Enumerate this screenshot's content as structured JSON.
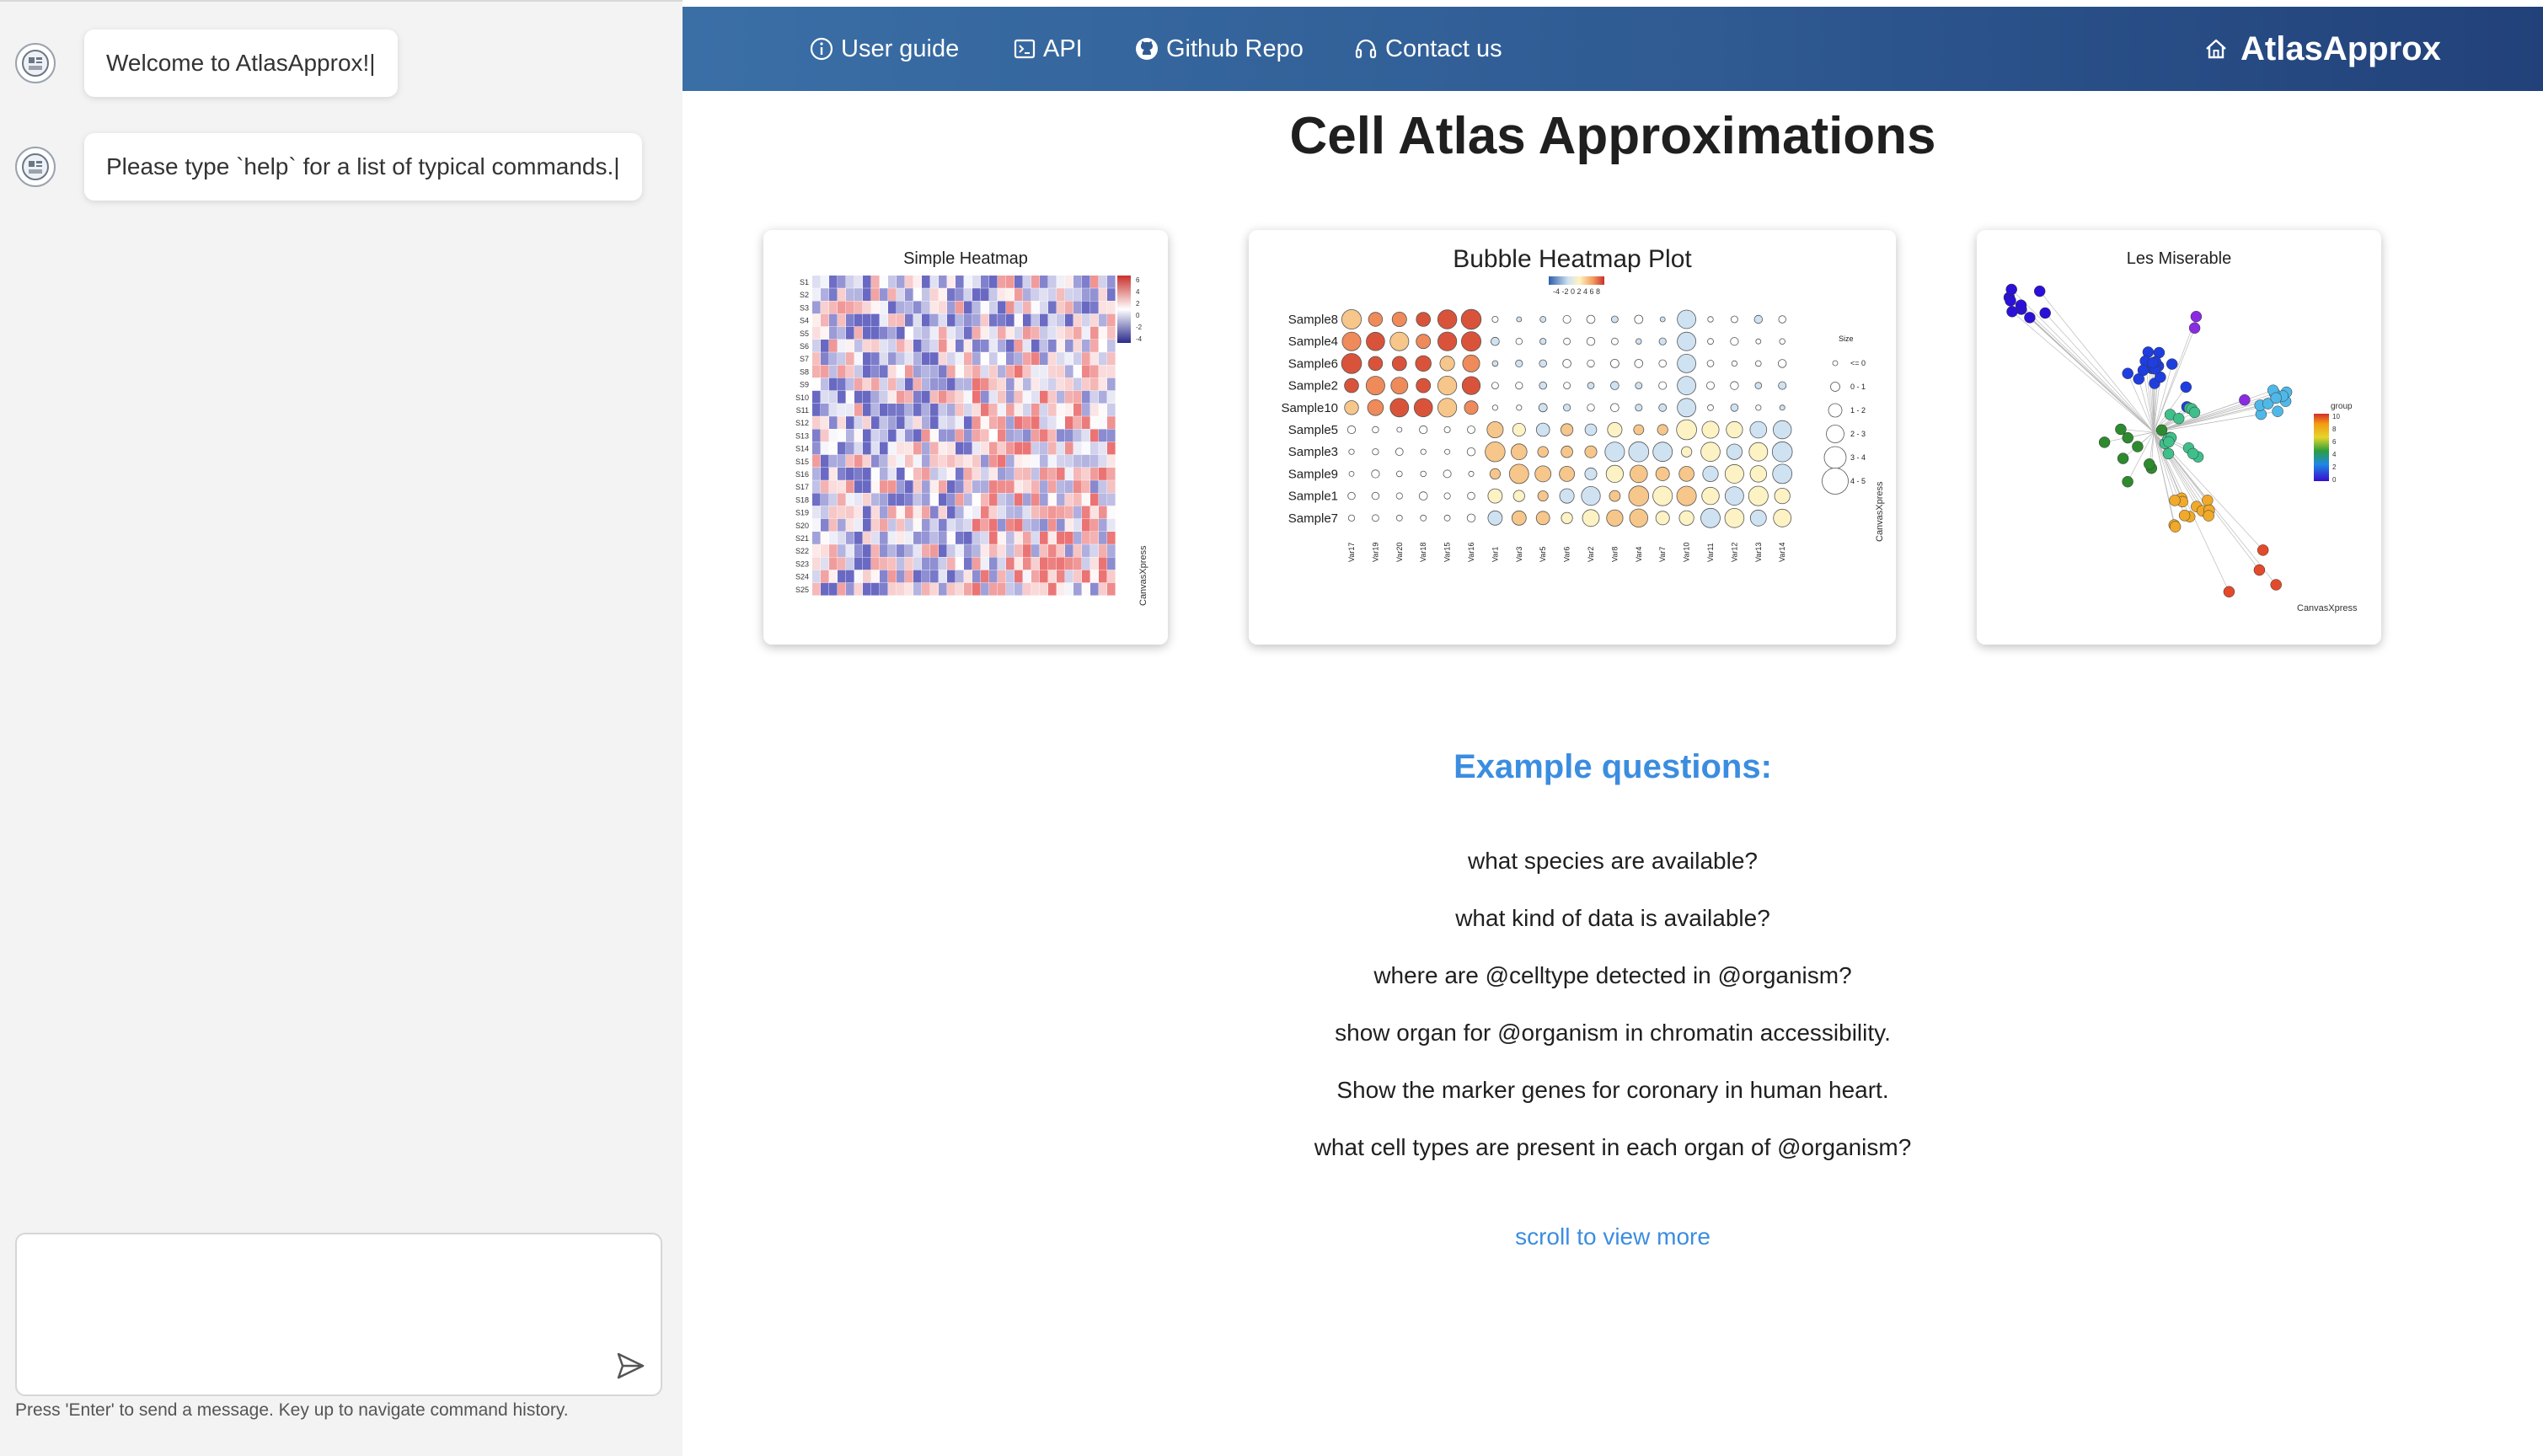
{
  "chat": {
    "messages": [
      {
        "text": "Welcome to AtlasApprox!|"
      },
      {
        "text": "Please type `help` for a list of typical commands.|"
      }
    ],
    "input_value": "",
    "hint": "Press 'Enter' to send a message. Key up to navigate command history."
  },
  "nav": {
    "items": [
      {
        "label": "User guide",
        "icon": "info-icon"
      },
      {
        "label": "API",
        "icon": "terminal-icon"
      },
      {
        "label": "Github Repo",
        "icon": "github-icon"
      },
      {
        "label": "Contact us",
        "icon": "headset-icon"
      }
    ],
    "brand": "AtlasApprox",
    "brand_icon": "home-icon",
    "color_start": "#3a6fa6",
    "color_end": "#22417a"
  },
  "main": {
    "title": "Cell Atlas Approximations",
    "examples_title": "Example questions:",
    "examples": [
      "what species are available?",
      "what kind of data is available?",
      "where are @celltype detected in @organism?",
      "show organ for @organism in chromatin accessibility.",
      "Show the marker genes for coronary in human heart.",
      "what cell types are present in each organ of @organism?"
    ],
    "scroll_more": "scroll to view more",
    "accent_color": "#3b8de0"
  },
  "cards": {
    "heatmap": {
      "title": "Simple Heatmap",
      "rows": [
        "S1",
        "S2",
        "S3",
        "S4",
        "S5",
        "S6",
        "S7",
        "S8",
        "S9",
        "S10",
        "S11",
        "S12",
        "S13",
        "S14",
        "S15",
        "S16",
        "S17",
        "S18",
        "S19",
        "S20",
        "S21",
        "S22",
        "S23",
        "S24",
        "S25"
      ],
      "legend_ticks": [
        "6",
        "4",
        "2",
        "0",
        "-2",
        "-4"
      ],
      "watermark": "CanvasXpress"
    },
    "bubble": {
      "title": "Bubble Heatmap Plot",
      "legend_scale": "-4 -2 0 2 4 6 8",
      "samples": [
        "Sample8",
        "Sample4",
        "Sample6",
        "Sample2",
        "Sample10",
        "Sample5",
        "Sample3",
        "Sample9",
        "Sample1",
        "Sample7"
      ],
      "vars": [
        "Var17",
        "Var19",
        "Var20",
        "Var18",
        "Var15",
        "Var16",
        "Var1",
        "Var3",
        "Var5",
        "Var6",
        "Var2",
        "Var8",
        "Var4",
        "Var7",
        "Var10",
        "Var11",
        "Var12",
        "Var13",
        "Var14"
      ],
      "size_title": "Size",
      "size_labels": [
        "<= 0",
        "0 - 1",
        "1 - 2",
        "2 - 3",
        "3 - 4",
        "4 - 5"
      ],
      "watermark": "CanvasXpress"
    },
    "network": {
      "title": "Les Miserable",
      "legend_title": "group",
      "legend_ticks": [
        "10",
        "8",
        "6",
        "4",
        "2",
        "0"
      ],
      "watermark": "CanvasXpress"
    }
  }
}
